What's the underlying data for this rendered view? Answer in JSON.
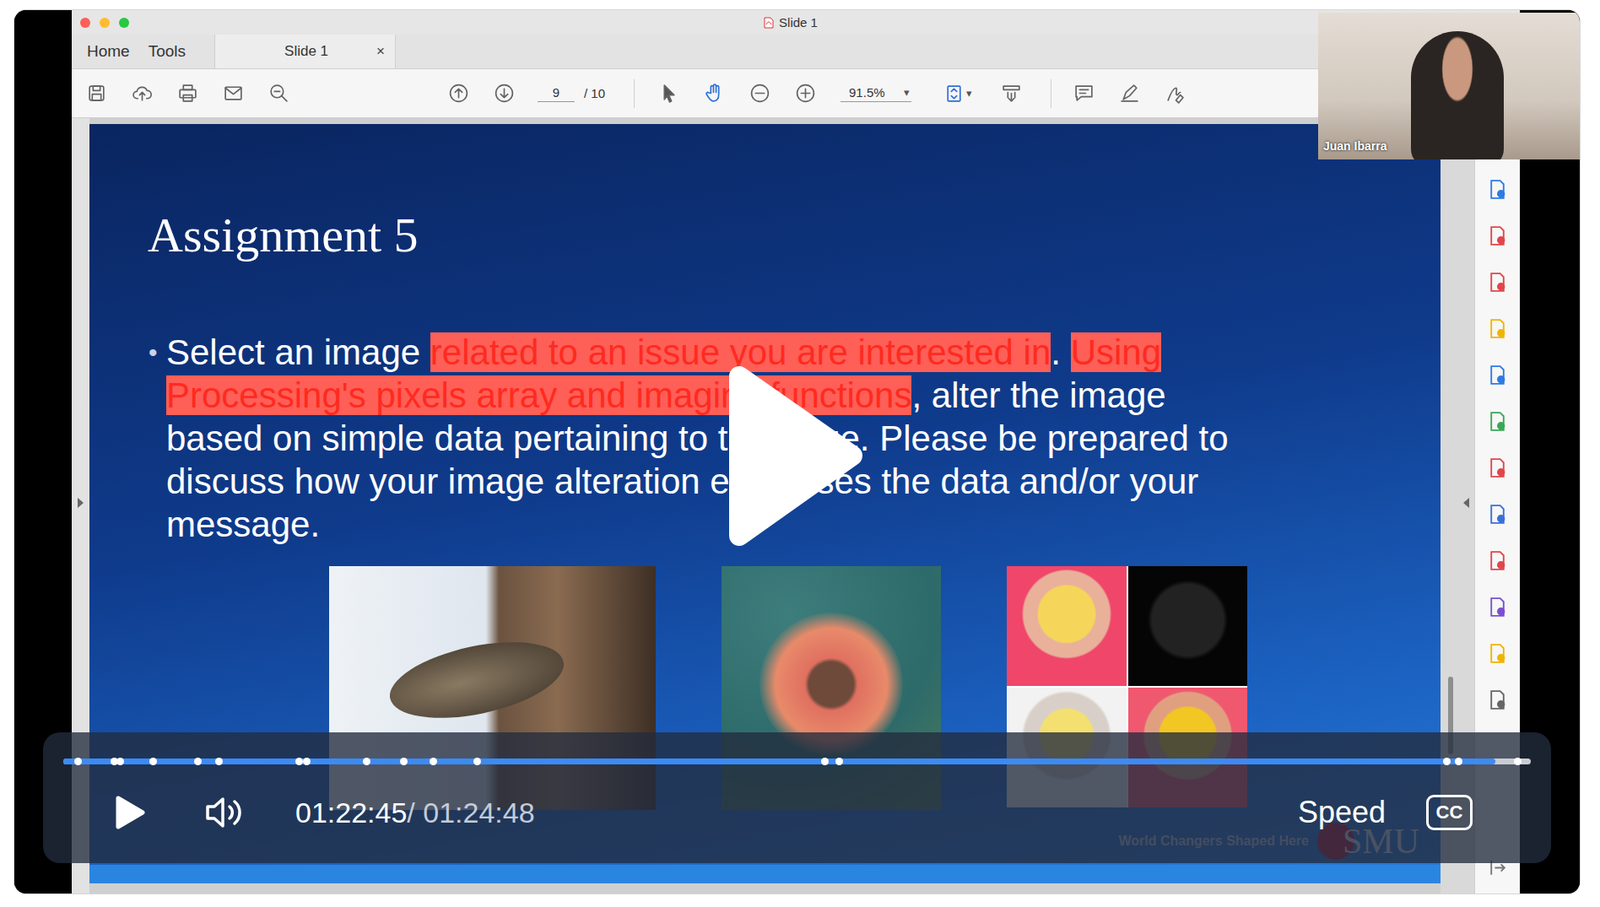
{
  "player": {
    "playing": false,
    "muted": false,
    "current_time": "01:22:45",
    "separator": "/",
    "duration": "01:24:48",
    "level": 0.976,
    "markers": [
      0.01,
      0.035,
      0.039,
      0.061,
      0.092,
      0.106,
      0.161,
      0.166,
      0.207,
      0.232,
      0.252,
      0.282,
      0.519,
      0.529,
      0.943,
      0.951,
      0.991
    ],
    "speed_label": "Speed",
    "cc_label": "CC"
  },
  "webcam": {
    "name": "Juan Ibarra"
  },
  "window": {
    "title": "Slide 1"
  },
  "tabs": [
    {
      "label": "Home",
      "selected": false,
      "close": ""
    },
    {
      "label": "Tools",
      "selected": false,
      "close": ""
    },
    {
      "label": "Slide 1",
      "selected": true,
      "close": "×"
    }
  ],
  "toolbar": {
    "page": "9",
    "page_count": "/ 10",
    "zoom": "91.5%",
    "dropdown": "▾"
  },
  "slide": {
    "title": "Assignment 5",
    "bullet": "•",
    "lines": [
      [
        {
          "text": "Select an image ",
          "highlight": false
        },
        {
          "text": "related to an issue you are interested in",
          "highlight": true
        },
        {
          "text": ". ",
          "highlight": false
        },
        {
          "text": "Using",
          "highlight": true
        }
      ],
      [
        {
          "text": "Processing's pixels array and imaging functions",
          "highlight": true
        },
        {
          "text": ", alter the image",
          "highlight": false
        }
      ],
      [
        {
          "text": "based on simple data pertaining to the issue. Please be prepared to",
          "highlight": false
        }
      ],
      [
        {
          "text": "discuss how your image alteration expresses the data and/or your",
          "highlight": false
        }
      ],
      [
        {
          "text": "message.",
          "highlight": false
        }
      ]
    ],
    "images": [
      {
        "kind": "cat"
      },
      {
        "kind": "flower"
      },
      {
        "kind": "grid"
      }
    ],
    "footer": "World Changers Shaped Here",
    "logo": "SMU"
  }
}
